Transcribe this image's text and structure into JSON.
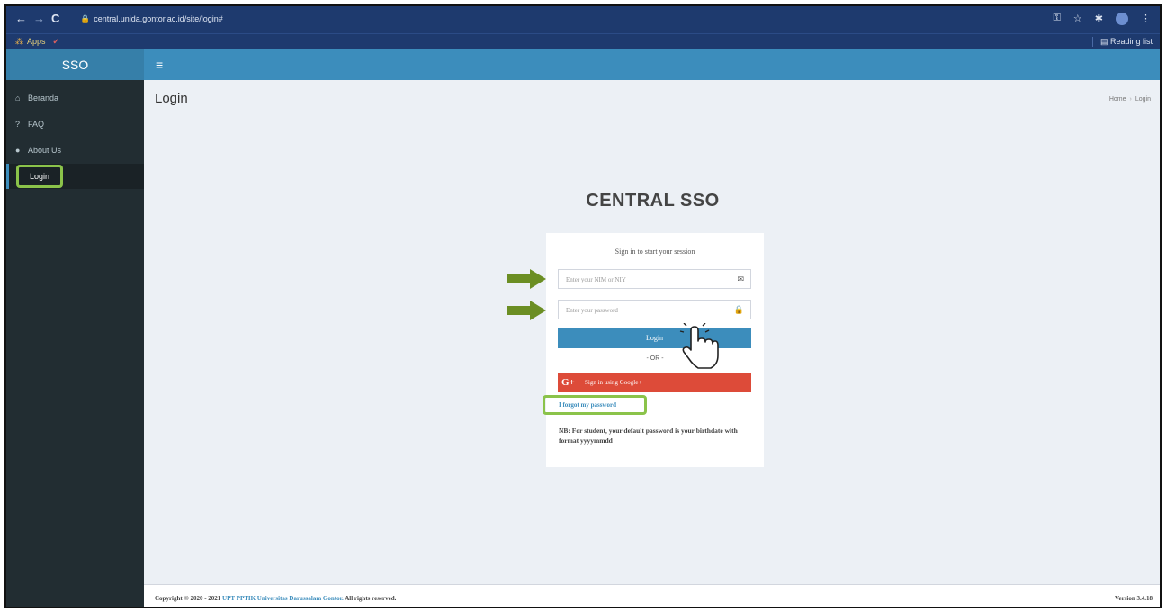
{
  "browser": {
    "url": "central.unida.gontor.ac.id/site/login#",
    "back_icon": "arrow-left-icon",
    "forward_icon": "arrow-right-icon",
    "reload_icon": "reload-icon",
    "bookmarks": {
      "apps_label": "Apps",
      "reading_list_label": "Reading list"
    }
  },
  "app": {
    "logo": "SSO"
  },
  "sidebar": {
    "items": [
      {
        "label": "Beranda",
        "icon": "home-icon"
      },
      {
        "label": "FAQ",
        "icon": "question-icon"
      },
      {
        "label": "About Us",
        "icon": "comment-icon"
      },
      {
        "label": "Login",
        "icon": ""
      }
    ]
  },
  "page": {
    "title": "Login",
    "breadcrumb": [
      "Home",
      "Login"
    ]
  },
  "login": {
    "brand": "CENTRAL SSO",
    "message": "Sign in to start your session",
    "username_placeholder": "Enter your NIM or NIY",
    "password_placeholder": "Enter your password",
    "login_button": "Login",
    "or_text": "- OR -",
    "google_button": "Sign in using Google+",
    "forgot_link": "I forgot my password",
    "note": "NB: For student, your default password is your birthdate with format yyyymmdd"
  },
  "footer": {
    "copyright_prefix": "Copyright © 2020 - 2021",
    "organization": "UPT PPTIK Universitas Darussalam Gontor.",
    "rights": "All rights reserved.",
    "version": "Version 3.4.18"
  },
  "colors": {
    "primary": "#3c8dbc",
    "google": "#dd4b39",
    "highlight": "#8bc34a",
    "sidebar": "#222d32",
    "arrow": "#6b8e23"
  }
}
